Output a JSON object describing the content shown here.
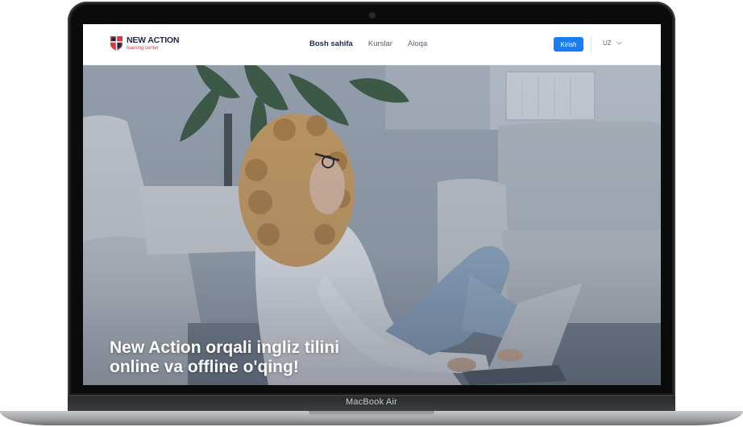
{
  "device": {
    "label": "MacBook Air"
  },
  "navbar": {
    "logo": {
      "title": "NEW ACTION",
      "subtitle": "learning center"
    },
    "links": [
      {
        "label": "Bosh sahifa",
        "active": true
      },
      {
        "label": "Kurslar",
        "active": false
      },
      {
        "label": "Aloqa",
        "active": false
      }
    ],
    "login_label": "Kirish",
    "language": "UZ"
  },
  "hero": {
    "headline_line1": "New Action orqali ingliz tilini",
    "headline_line2": "online va offline o'qing!",
    "image": "woman-with-laptop-photo"
  },
  "colors": {
    "accent": "#1a7cf5",
    "brand_navy": "#1c2a4a",
    "brand_red": "#d9363e"
  }
}
